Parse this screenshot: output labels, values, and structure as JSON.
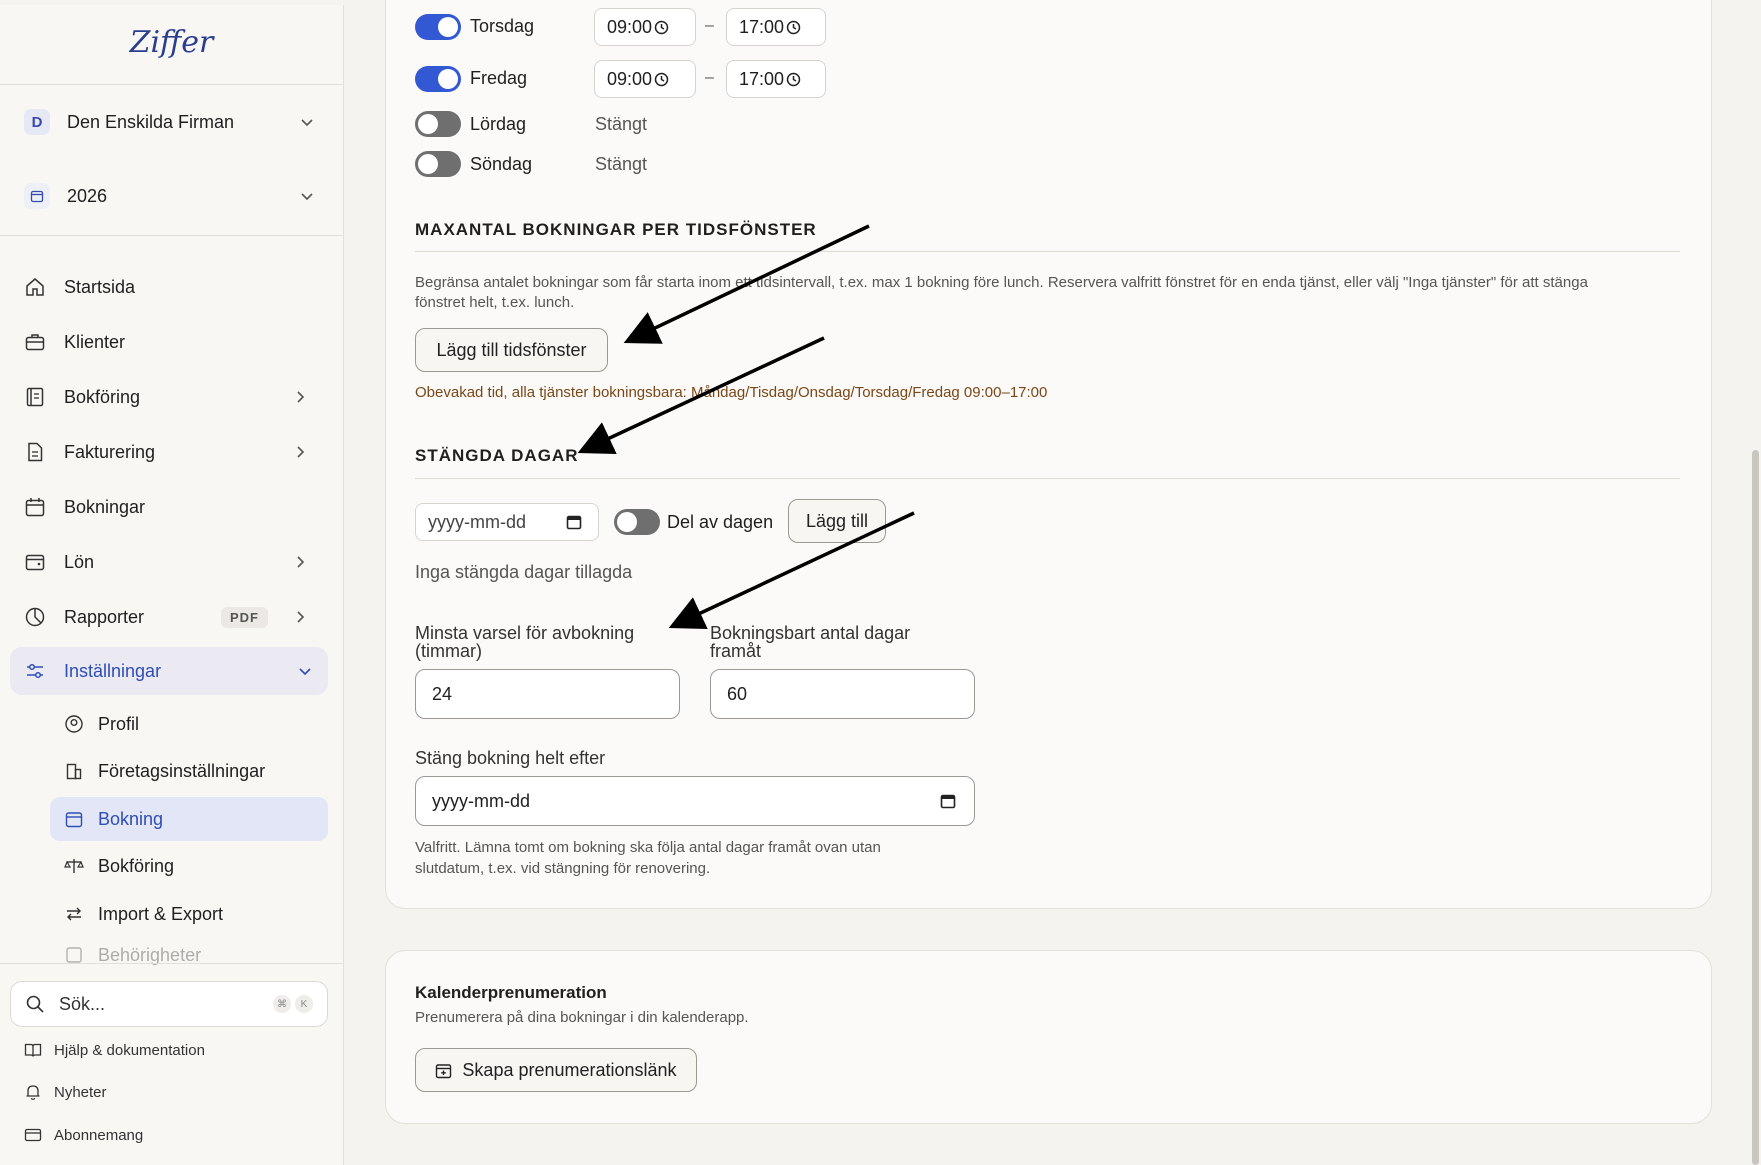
{
  "sidebar": {
    "logo": "Ziffer",
    "company": {
      "badge": "D",
      "name": "Den Enskilda Firman"
    },
    "year": "2026",
    "nav": [
      {
        "label": "Startsida"
      },
      {
        "label": "Klienter"
      },
      {
        "label": "Bokföring"
      },
      {
        "label": "Fakturering"
      },
      {
        "label": "Bokningar"
      },
      {
        "label": "Lön"
      },
      {
        "label": "Rapporter",
        "badge": "PDF"
      },
      {
        "label": "Inställningar"
      }
    ],
    "subnav": [
      {
        "label": "Profil"
      },
      {
        "label": "Företagsinställningar"
      },
      {
        "label": "Bokning"
      },
      {
        "label": "Bokföring"
      },
      {
        "label": "Import & Export"
      },
      {
        "label": "Behörigheter"
      }
    ],
    "search": {
      "placeholder": "Sök...",
      "kbd1": "⌘",
      "kbd2": "K"
    },
    "footer": [
      {
        "label": "Hjälp & dokumentation"
      },
      {
        "label": "Nyheter"
      },
      {
        "label": "Abonnemang"
      }
    ]
  },
  "hours": [
    {
      "day": "Torsdag",
      "enabled": true,
      "start": "09:00",
      "end": "17:00"
    },
    {
      "day": "Fredag",
      "enabled": true,
      "start": "09:00",
      "end": "17:00"
    },
    {
      "day": "Lördag",
      "enabled": false,
      "status": "Stängt"
    },
    {
      "day": "Söndag",
      "enabled": false,
      "status": "Stängt"
    }
  ],
  "dash": "–",
  "max_bookings": {
    "title": "MAXANTAL BOKNINGAR PER TIDSFÖNSTER",
    "desc1": "Begränsa antalet bokningar som får starta inom ett tidsintervall, t.ex. max 1 bokning före lunch. Reservera valfritt fönstret för en enda tjänst, eller välj \"Inga tjänster\" för att stänga",
    "desc2": "fönstret helt, t.ex. lunch.",
    "button": "Lägg till tidsfönster",
    "note": "Obevakad tid, alla tjänster bokningsbara: Måndag/Tisdag/Onsdag/Torsdag/Fredag 09:00–17:00"
  },
  "closed_days": {
    "title": "STÄNGDA DAGAR",
    "date_placeholder": "yyyy-mm-dd",
    "partial_label": "Del av dagen",
    "add_button": "Lägg till",
    "empty": "Inga stängda dagar tillagda"
  },
  "cancel_notice": {
    "label1": "Minsta varsel för avbokning",
    "label2": "(timmar)",
    "value": "24"
  },
  "days_ahead": {
    "label1": "Bokningsbart antal dagar",
    "label2": "framåt",
    "value": "60"
  },
  "close_after": {
    "label": "Stäng bokning helt efter",
    "placeholder": "yyyy-mm-dd",
    "help1": "Valfritt. Lämna tomt om bokning ska följa antal dagar framåt ovan utan",
    "help2": "slutdatum, t.ex. vid stängning för renovering."
  },
  "calendar_sub": {
    "title": "Kalenderprenumeration",
    "desc": "Prenumerera på dina bokningar i din kalenderapp.",
    "button": "Skapa prenumerationslänk"
  },
  "colors": {
    "accent": "#3358d4",
    "note": "#7a4716",
    "bg": "#f5f3ef"
  }
}
